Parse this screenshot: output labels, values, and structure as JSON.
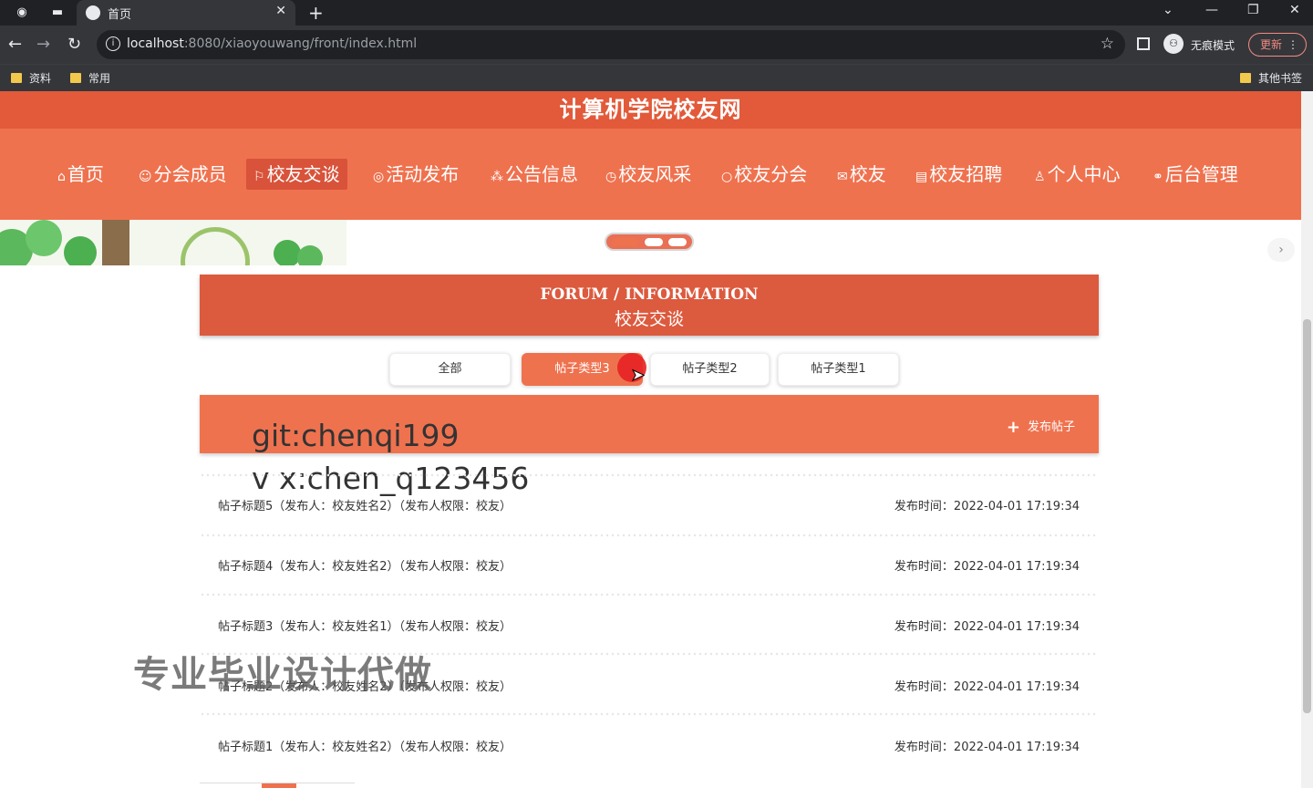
{
  "browser": {
    "tab_title": "首页",
    "url_host": "localhost",
    "url_path": ":8080/xiaoyouwang/front/index.html",
    "incognito_label": "无痕模式",
    "update_label": "更新",
    "bookmarks": [
      "资料",
      "常用"
    ],
    "other_bookmarks": "其他书签"
  },
  "site": {
    "title": "计算机学院校友网"
  },
  "nav": {
    "items": [
      {
        "icon": "⌂",
        "label": "首页"
      },
      {
        "icon": "☺",
        "label": "分会成员"
      },
      {
        "icon": "⚐",
        "label": "校友交谈"
      },
      {
        "icon": "◎",
        "label": "活动发布"
      },
      {
        "icon": "⁂",
        "label": "公告信息"
      },
      {
        "icon": "◷",
        "label": "校友风采"
      },
      {
        "icon": "○",
        "label": "校友分会"
      },
      {
        "icon": "✉",
        "label": "校友"
      },
      {
        "icon": "▤",
        "label": "校友招聘"
      },
      {
        "icon": "♙",
        "label": "个人中心"
      },
      {
        "icon": "⚭",
        "label": "后台管理"
      }
    ],
    "active_index": 2
  },
  "forum": {
    "heading_en": "FORUM / INFORMATION",
    "heading_cn": "校友交谈",
    "filters": [
      "全部",
      "帖子类型3",
      "帖子类型2",
      "帖子类型1"
    ],
    "active_filter": "帖子类型3",
    "add_post_label": "发布帖子",
    "posts": [
      {
        "title": "帖子标题5（发布人：校友姓名2）（发布人权限：校友）",
        "time": "发布时间：2022-04-01 17:19:34"
      },
      {
        "title": "帖子标题4（发布人：校友姓名2）（发布人权限：校友）",
        "time": "发布时间：2022-04-01 17:19:34"
      },
      {
        "title": "帖子标题3（发布人：校友姓名1）（发布人权限：校友）",
        "time": "发布时间：2022-04-01 17:19:34"
      },
      {
        "title": "帖子标题2（发布人：校友姓名2）（发布人权限：校友）",
        "time": "发布时间：2022-04-01 17:19:34"
      },
      {
        "title": "帖子标题1（发布人：校友姓名2）（发布人权限：校友）",
        "time": "发布时间：2022-04-01 17:19:34"
      }
    ]
  },
  "overlay": {
    "line1": "git:chenqi199",
    "line2": "v x:chen_q123456",
    "promo": "专业毕业设计代做"
  }
}
